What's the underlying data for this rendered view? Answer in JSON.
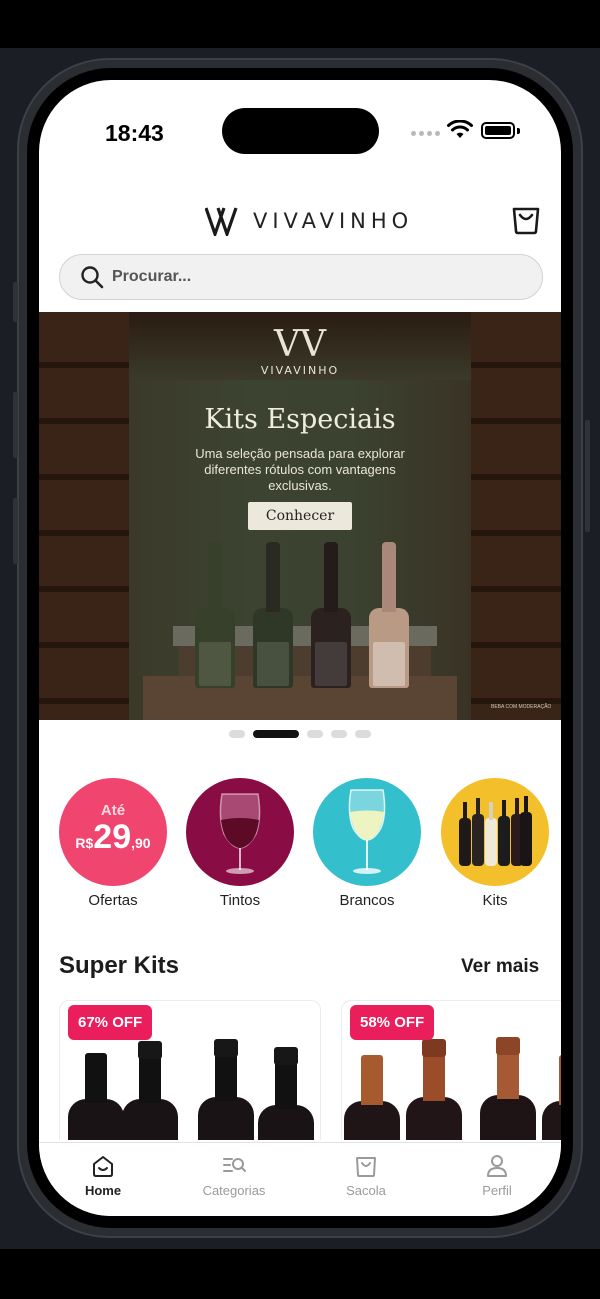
{
  "status_bar": {
    "time": "18:43"
  },
  "header": {
    "brand": "VIVAVINHO",
    "logo_mark": "VV"
  },
  "search": {
    "placeholder": "Procurar..."
  },
  "banner": {
    "brand": "VIVAVINHO",
    "logo_mark": "VV",
    "title": "Kits Especiais",
    "subtitle": "Uma seleção pensada para explorar diferentes rótulos com vantagens exclusivas.",
    "cta_label": "Conhecer",
    "disclaimer": "BEBA COM MODERAÇÃO",
    "carousel": {
      "active_index": 1,
      "count": 5
    }
  },
  "categories": [
    {
      "label": "Ofertas",
      "color": "#f0456f",
      "offer_prefix": "Até",
      "offer_currency": "R$",
      "offer_value": "29",
      "offer_cents": ",90"
    },
    {
      "label": "Tintos",
      "color": "#8a0c44"
    },
    {
      "label": "Brancos",
      "color": "#33bfcc"
    },
    {
      "label": "Kits",
      "color": "#f3c02c"
    }
  ],
  "super_kits": {
    "title": "Super Kits",
    "see_more": "Ver mais",
    "items": [
      {
        "badge": "67% OFF"
      },
      {
        "badge": "58% OFF"
      }
    ]
  },
  "tabbar": {
    "items": [
      {
        "label": "Home",
        "icon": "home-icon",
        "active": true
      },
      {
        "label": "Categorias",
        "icon": "categories-icon",
        "active": false
      },
      {
        "label": "Sacola",
        "icon": "bag-icon",
        "active": false
      },
      {
        "label": "Perfil",
        "icon": "profile-icon",
        "active": false
      }
    ]
  },
  "colors": {
    "accent": "#e91e5b",
    "text": "#1c1c1c",
    "tab_inactive": "#9a9a9a"
  }
}
